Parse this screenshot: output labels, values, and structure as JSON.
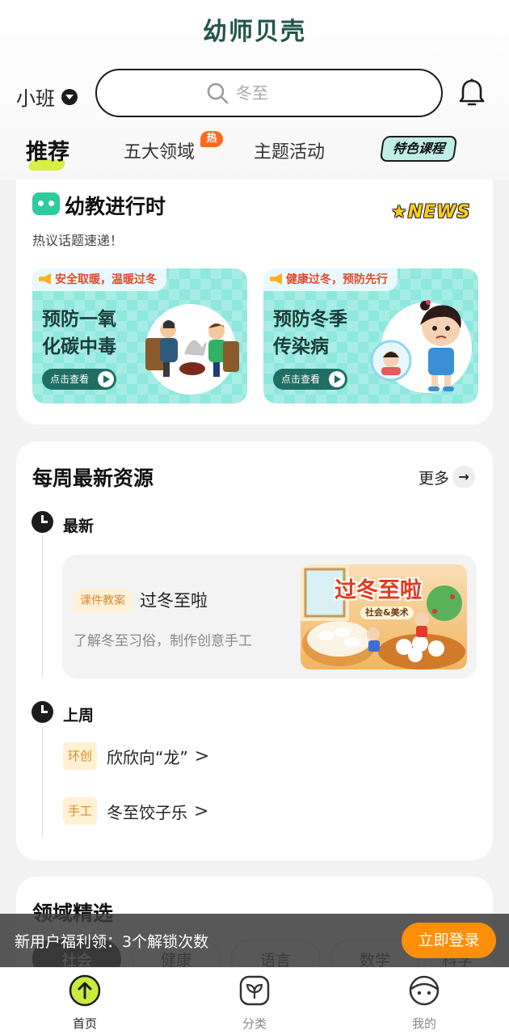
{
  "header": {
    "logo": "幼师贝壳",
    "class_select": "小班",
    "search_placeholder": "冬至"
  },
  "tabs": [
    {
      "label": "推荐",
      "active": true
    },
    {
      "label": "五大领域",
      "badge": "热"
    },
    {
      "label": "主题活动"
    },
    {
      "label": "特色课程"
    }
  ],
  "news_section": {
    "title": "幼教进行时",
    "news_label": "NEWS",
    "subtitle": "热议话题速递！",
    "banners": [
      {
        "tag": "安全取暖，温暖过冬",
        "title": "预防一氧\n化碳中毒",
        "button": "点击查看"
      },
      {
        "tag": "健康过冬，预防先行",
        "title": "预防冬季\n传染病",
        "button": "点击查看"
      }
    ]
  },
  "weekly": {
    "title": "每周最新资源",
    "more": "更多",
    "latest_label": "最新",
    "latest": {
      "tag": "课件教案",
      "title": "过冬至啦",
      "desc": "了解冬至习俗，制作创意手工",
      "image_title": "过冬至啦",
      "image_sub": "社会&美术"
    },
    "lastweek_label": "上周",
    "lastweek": [
      {
        "tag": "环创",
        "title": "欣欣向“龙”"
      },
      {
        "tag": "手工",
        "title": "冬至饺子乐"
      }
    ]
  },
  "domain": {
    "title": "领域精选",
    "chips": [
      "社会",
      "健康",
      "语言",
      "数学",
      "科学"
    ]
  },
  "promo": {
    "text": "新用户福利领：3个解锁次数",
    "button": "立即登录"
  },
  "nav": [
    {
      "label": "首页",
      "icon": "home-arrow-icon",
      "active": true
    },
    {
      "label": "分类",
      "icon": "category-icon"
    },
    {
      "label": "我的",
      "icon": "profile-face-icon"
    }
  ],
  "colors": {
    "brand_green": "#23564a",
    "accent_orange": "#ff8f0a",
    "banner_mint": "#8ee8de",
    "hot_badge": "#ff6a1a"
  }
}
